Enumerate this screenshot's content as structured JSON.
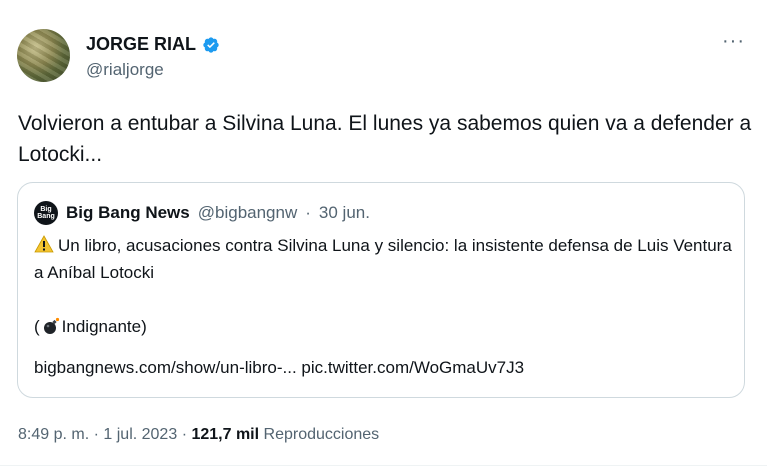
{
  "author": {
    "name": "JORGE RIAL",
    "handle": "@rialjorge"
  },
  "tweet": {
    "text": "Volvieron a entubar a Silvina Luna. El lunes ya sabemos quien va a defender a Lotocki..."
  },
  "quoted": {
    "avatar_text": "Big Bang",
    "name": "Big Bang News",
    "handle": "@bigbangnw",
    "separator": "·",
    "date": "30 jun.",
    "line1": "Un libro, acusaciones contra Silvina Luna y silencio: la insistente defensa de Luis Ventura a Aníbal Lotocki",
    "reaction_open": "(",
    "reaction_label": "Indignante)",
    "link": "bigbangnews.com/show/un-libro-...",
    "pic": "pic.twitter.com/WoGmaUv7J3"
  },
  "footer": {
    "time": "8:49 p. m.",
    "date": "1 jul. 2023",
    "views_count": "121,7 mil",
    "views_label": "Reproducciones",
    "dot": "·"
  },
  "colors": {
    "verified": "#1d9bf0",
    "secondary": "#536471",
    "border": "#cfd9de"
  },
  "icons": [
    "verified-badge-icon",
    "more-options-icon",
    "warning-icon",
    "bomb-icon"
  ]
}
